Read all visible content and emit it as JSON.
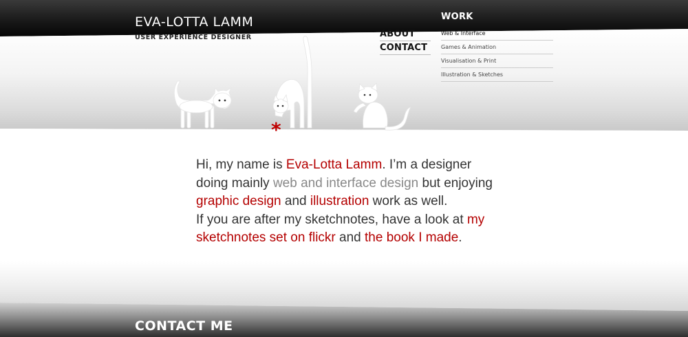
{
  "header": {
    "title": "EVA-LOTTA LAMM",
    "tagline": "USER EXPERIENCE DESIGNER"
  },
  "nav": {
    "main": [
      "ABOUT",
      "CONTACT"
    ],
    "work_heading": "WORK",
    "work_items": [
      "Web & Interface",
      "Games & Animation",
      "Visualisation & Print",
      "Illustration & Sketches"
    ]
  },
  "intro": {
    "s1": "Hi, my name is ",
    "name": "Eva-Lotta Lamm",
    "s2": ". I’m a designer doing mainly ",
    "web": "web and interface design",
    "s3": " but enjoying ",
    "graphic": "graphic design",
    "s4": " and ",
    "illustration": "illustration",
    "s5": " work as well.",
    "s6": "If you are after my sketchnotes, have a look at ",
    "flickr": "my sketchnotes set on flickr",
    "s7": " and ",
    "book": "the book I made",
    "s8": "."
  },
  "footer": {
    "contact_heading": "CONTACT ME"
  },
  "decor": {
    "asterisk": "*"
  },
  "colors": {
    "accent": "#b40000",
    "link_grey": "#888888",
    "header_dark": "#1a1a1a",
    "text": "#333333"
  }
}
